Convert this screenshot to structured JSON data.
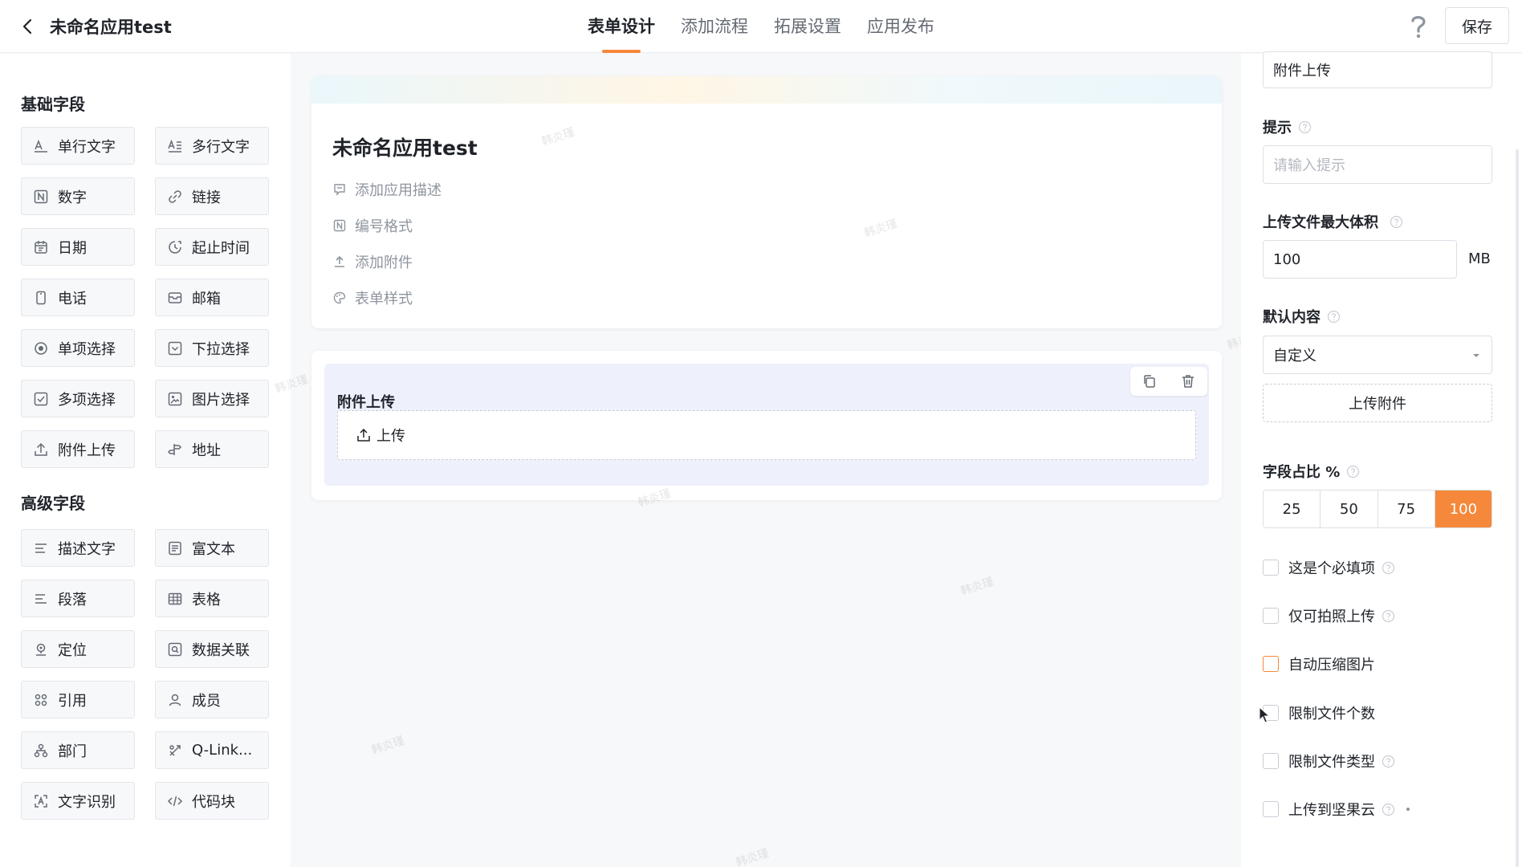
{
  "header": {
    "title": "未命名应用test",
    "tabs": [
      {
        "label": "表单设计",
        "active": true
      },
      {
        "label": "添加流程",
        "active": false
      },
      {
        "label": "拓展设置",
        "active": false
      },
      {
        "label": "应用发布",
        "active": false
      }
    ],
    "save_label": "保存",
    "accent_color": "#f5883a"
  },
  "sidebar": {
    "basic_title": "基础字段",
    "basic_fields": [
      {
        "label": "单行文字",
        "icon": "single-line-text-icon"
      },
      {
        "label": "多行文字",
        "icon": "multi-line-text-icon"
      },
      {
        "label": "数字",
        "icon": "number-icon"
      },
      {
        "label": "链接",
        "icon": "link-icon"
      },
      {
        "label": "日期",
        "icon": "calendar-icon"
      },
      {
        "label": "起止时间",
        "icon": "time-range-icon"
      },
      {
        "label": "电话",
        "icon": "phone-icon"
      },
      {
        "label": "邮箱",
        "icon": "mail-icon"
      },
      {
        "label": "单项选择",
        "icon": "radio-icon"
      },
      {
        "label": "下拉选择",
        "icon": "dropdown-icon"
      },
      {
        "label": "多项选择",
        "icon": "checkbox-icon"
      },
      {
        "label": "图片选择",
        "icon": "image-icon"
      },
      {
        "label": "附件上传",
        "icon": "upload-icon"
      },
      {
        "label": "地址",
        "icon": "address-icon"
      }
    ],
    "advanced_title": "高级字段",
    "advanced_fields": [
      {
        "label": "描述文字",
        "icon": "description-icon"
      },
      {
        "label": "富文本",
        "icon": "rich-text-icon"
      },
      {
        "label": "段落",
        "icon": "paragraph-icon"
      },
      {
        "label": "表格",
        "icon": "table-icon"
      },
      {
        "label": "定位",
        "icon": "location-icon"
      },
      {
        "label": "数据关联",
        "icon": "data-link-icon"
      },
      {
        "label": "引用",
        "icon": "reference-icon"
      },
      {
        "label": "成员",
        "icon": "member-icon"
      },
      {
        "label": "部门",
        "icon": "department-icon"
      },
      {
        "label": "Q-Link...",
        "icon": "q-link-icon"
      },
      {
        "label": "文字识别",
        "icon": "ocr-icon"
      },
      {
        "label": "代码块",
        "icon": "code-icon"
      }
    ]
  },
  "form": {
    "title": "未命名应用test",
    "options": [
      "添加应用描述",
      "编号格式",
      "添加附件",
      "表单样式"
    ],
    "field_label": "附件上传",
    "upload_label": "上传"
  },
  "watermark_text": "韩炎瑾",
  "properties": {
    "title_value": "附件上传",
    "hint_label": "提示",
    "hint_placeholder": "请输入提示",
    "max_size_label": "上传文件最大体积",
    "max_size_value": "100",
    "max_size_unit": "MB",
    "default_label": "默认内容",
    "default_value": "自定义",
    "upload_attachment_label": "上传附件",
    "width_label": "字段占比 %",
    "width_options": [
      "25",
      "50",
      "75",
      "100"
    ],
    "width_selected": "100",
    "checkboxes": [
      {
        "label": "这是个必填项",
        "help": true,
        "checked": false
      },
      {
        "label": "仅可拍照上传",
        "help": true,
        "checked": false
      },
      {
        "label": "自动压缩图片",
        "help": false,
        "checked": false
      },
      {
        "label": "限制文件个数",
        "help": false,
        "checked": false
      },
      {
        "label": "限制文件类型",
        "help": true,
        "checked": false
      },
      {
        "label": "上传到坚果云",
        "help": true,
        "checked": false
      }
    ]
  }
}
